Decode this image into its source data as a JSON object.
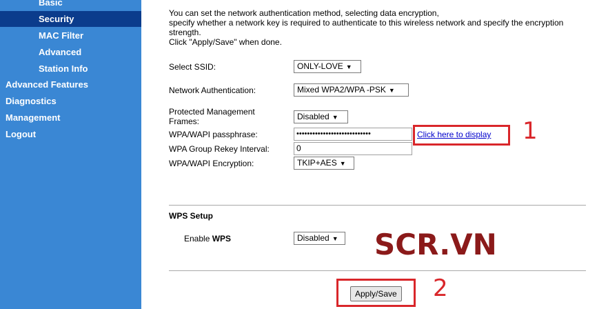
{
  "sidebar": {
    "items": [
      {
        "label": "Basic"
      },
      {
        "label": "Security"
      },
      {
        "label": "MAC Filter"
      },
      {
        "label": "Advanced"
      },
      {
        "label": "Station Info"
      },
      {
        "label": "Advanced Features"
      },
      {
        "label": "Diagnostics"
      },
      {
        "label": "Management"
      },
      {
        "label": "Logout"
      }
    ],
    "active": "Security"
  },
  "intro": {
    "line1": "You can set the network authentication method, selecting data encryption,",
    "line2": "specify whether a network key is required to authenticate to this wireless network and specify the encryption strength.",
    "line3": "Click \"Apply/Save\" when done."
  },
  "form": {
    "ssid": {
      "label": "Select SSID:",
      "value": "ONLY-LOVE"
    },
    "auth": {
      "label": "Network Authentication:",
      "value": "Mixed WPA2/WPA -PSK"
    },
    "pmf": {
      "label": "Protected Management Frames:",
      "value": "Disabled"
    },
    "passphrase": {
      "label": "WPA/WAPI passphrase:",
      "value": "••••••••••••••••••••••••••••",
      "display_link": "Click here to display"
    },
    "rekey": {
      "label": "WPA Group Rekey Interval:",
      "value": "0"
    },
    "encryption": {
      "label": "WPA/WAPI Encryption:",
      "value": "TKIP+AES"
    }
  },
  "wps": {
    "title": "WPS Setup",
    "enable_label_prefix": "Enable ",
    "enable_label_bold": "WPS",
    "value": "Disabled"
  },
  "annotations": {
    "num1": "1",
    "num2": "2",
    "watermark": "SCR.VN"
  },
  "apply_label": "Apply/Save",
  "colors": {
    "sidebar": "#3a87d4",
    "sidebar_active": "#0b3c8c",
    "annotation": "#d9262a",
    "watermark": "#8b1a1a"
  }
}
